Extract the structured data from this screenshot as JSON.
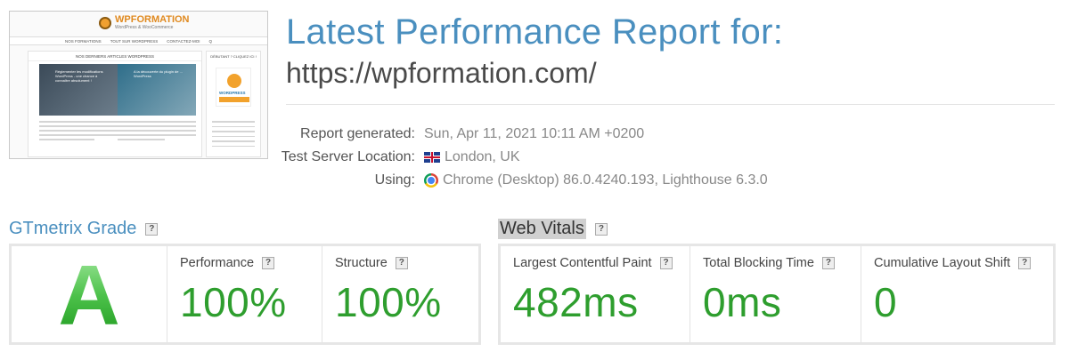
{
  "thumbnail": {
    "brand": "WPFORMATION",
    "tagline": "WordPress & WooCommerce",
    "nav": [
      "NOS FORMATIONS",
      "TOUT SUR WORDPRESS",
      "CONTACTEZ-MOI",
      "Q"
    ],
    "main_heading": "NOS DERNIERS ARTICLES WORDPRESS",
    "post1": "Réglementer les modifications WordPress - une chance à connaître absolument !",
    "post2": "A la découverte du plugin de ... WordPress",
    "side_heading": "DÉBUTANT ? CLIQUEZ ICI !",
    "side_logo": "WORDPRESS"
  },
  "header": {
    "title": "Latest Performance Report for:",
    "url": "https://wpformation.com/"
  },
  "meta": {
    "report_generated_label": "Report generated:",
    "report_generated_value": "Sun, Apr 11, 2021 10:11 AM +0200",
    "server_label": "Test Server Location:",
    "server_value": "London, UK",
    "using_label": "Using:",
    "using_value": "Chrome (Desktop) 86.0.4240.193, Lighthouse 6.3.0"
  },
  "gtmetrix": {
    "title": "GTmetrix Grade",
    "help": "?",
    "grade": "A",
    "grade_color": "#2e9e2e",
    "performance_label": "Performance",
    "performance_value": "100%",
    "structure_label": "Structure",
    "structure_value": "100%"
  },
  "web_vitals": {
    "title": "Web Vitals",
    "help": "?",
    "lcp_label": "Largest Contentful Paint",
    "lcp_value": "482ms",
    "tbt_label": "Total Blocking Time",
    "tbt_value": "0ms",
    "cls_label": "Cumulative Layout Shift",
    "cls_value": "0",
    "value_color": "#2e9e2e"
  },
  "icons": {
    "flag": "uk-flag-icon",
    "browser": "chrome-icon",
    "help": "help-icon"
  }
}
